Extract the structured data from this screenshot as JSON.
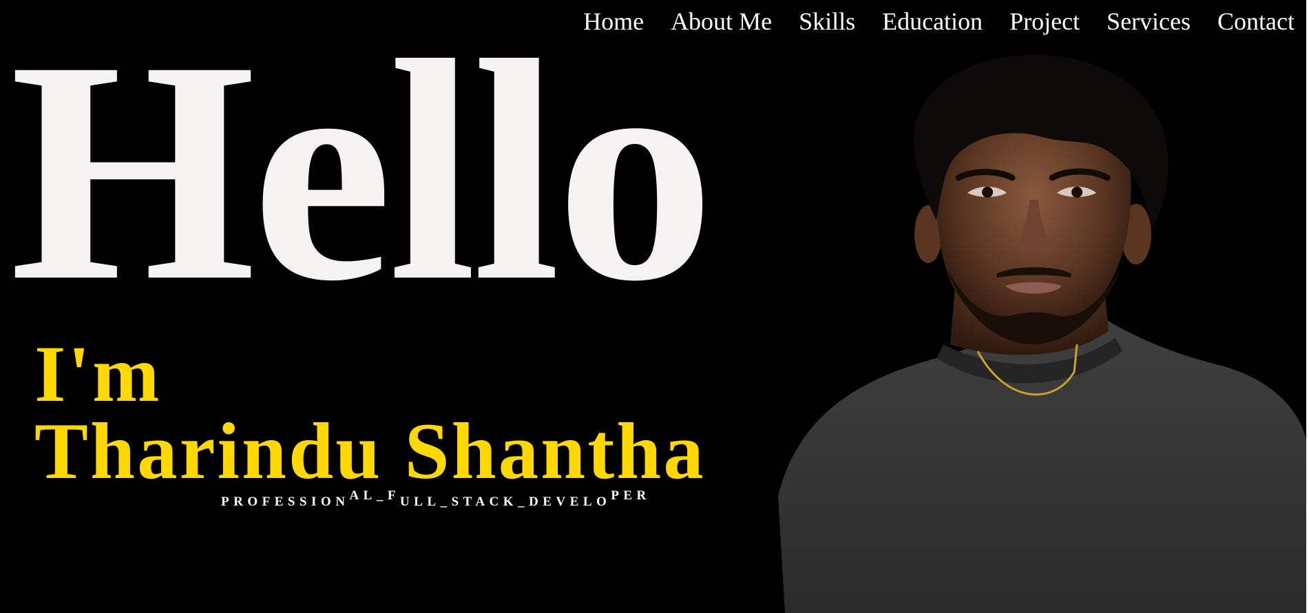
{
  "nav": {
    "items": [
      "Home",
      "About Me",
      "Skills",
      "Education",
      "Project",
      "Services",
      "Contact"
    ]
  },
  "hero": {
    "greeting": "Hello",
    "intro_line": "I'm",
    "name": "Tharindu Shantha",
    "subtitle_parts": [
      "PROFESSION",
      "AL_F",
      "ULL_STACK_DEVELO",
      "PER"
    ]
  },
  "colors": {
    "background": "#000000",
    "greeting": "#f5f2f2",
    "accent": "#fed800",
    "nav_text": "#ffffff"
  }
}
